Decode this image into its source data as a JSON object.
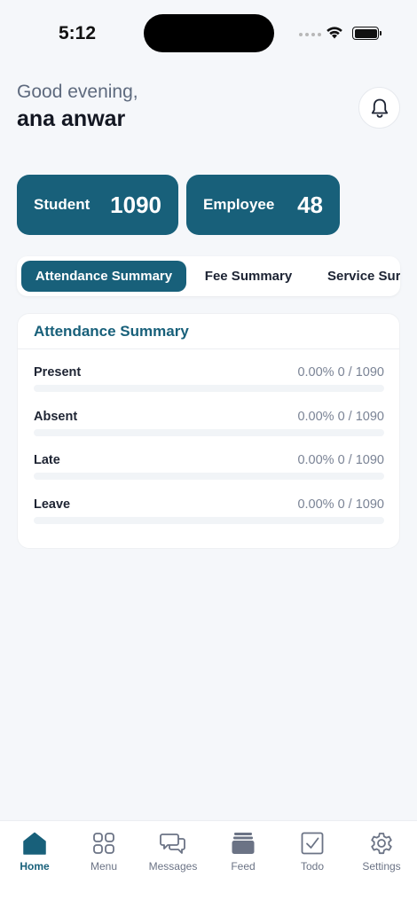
{
  "status_bar": {
    "time": "5:12"
  },
  "header": {
    "greeting": "Good evening,",
    "username": "ana anwar",
    "bell_icon": "bell-icon"
  },
  "stats": [
    {
      "label": "Student",
      "value": "1090"
    },
    {
      "label": "Employee",
      "value": "48"
    }
  ],
  "tabs": [
    {
      "label": "Attendance Summary",
      "active": true
    },
    {
      "label": "Fee Summary",
      "active": false
    },
    {
      "label": "Service Sur",
      "active": false
    }
  ],
  "summary": {
    "title": "Attendance Summary",
    "rows": [
      {
        "label": "Present",
        "value": "0.00% 0 / 1090",
        "progress": 0
      },
      {
        "label": "Absent",
        "value": "0.00% 0 / 1090",
        "progress": 0
      },
      {
        "label": "Late",
        "value": "0.00% 0 / 1090",
        "progress": 0
      },
      {
        "label": "Leave",
        "value": "0.00% 0 / 1090",
        "progress": 0
      }
    ]
  },
  "nav": [
    {
      "label": "Home",
      "icon": "home-icon",
      "active": true
    },
    {
      "label": "Menu",
      "icon": "grid-icon",
      "active": false
    },
    {
      "label": "Messages",
      "icon": "chat-icon",
      "active": false
    },
    {
      "label": "Feed",
      "icon": "feed-icon",
      "active": false
    },
    {
      "label": "Todo",
      "icon": "checkbox-icon",
      "active": false
    },
    {
      "label": "Settings",
      "icon": "gear-icon",
      "active": false
    }
  ],
  "colors": {
    "primary": "#18607a",
    "background": "#f5f7fa",
    "muted_text": "#7a8395"
  }
}
